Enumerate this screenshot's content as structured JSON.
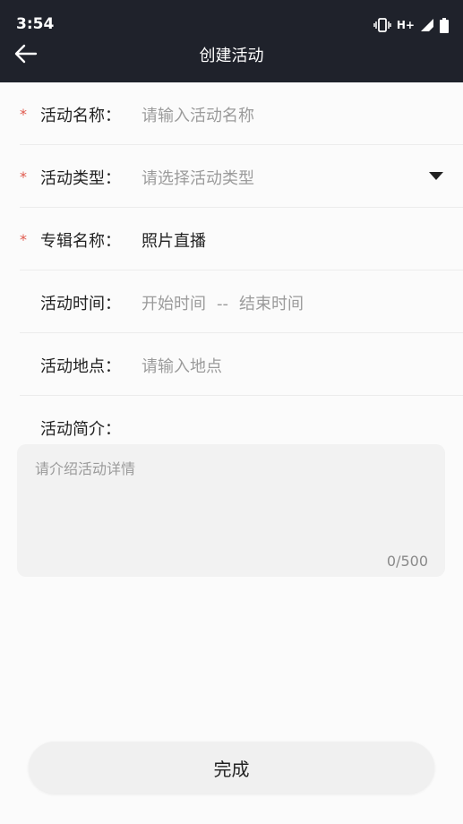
{
  "status_bar": {
    "time": "3:54",
    "network": "H+"
  },
  "nav": {
    "title": "创建活动"
  },
  "form": {
    "required_mark": "*",
    "name": {
      "label": "活动名称：",
      "placeholder": "请输入活动名称"
    },
    "type": {
      "label": "活动类型：",
      "placeholder": "请选择活动类型"
    },
    "album": {
      "label": "专辑名称：",
      "value": "照片直播"
    },
    "time": {
      "label": "活动时间：",
      "start_placeholder": "开始时间",
      "separator": "--",
      "end_placeholder": "结束时间"
    },
    "location": {
      "label": "活动地点：",
      "placeholder": "请输入地点"
    },
    "intro": {
      "label": "活动简介：",
      "placeholder": "请介绍活动详情",
      "counter": "0/500"
    }
  },
  "actions": {
    "done_label": "完成"
  }
}
